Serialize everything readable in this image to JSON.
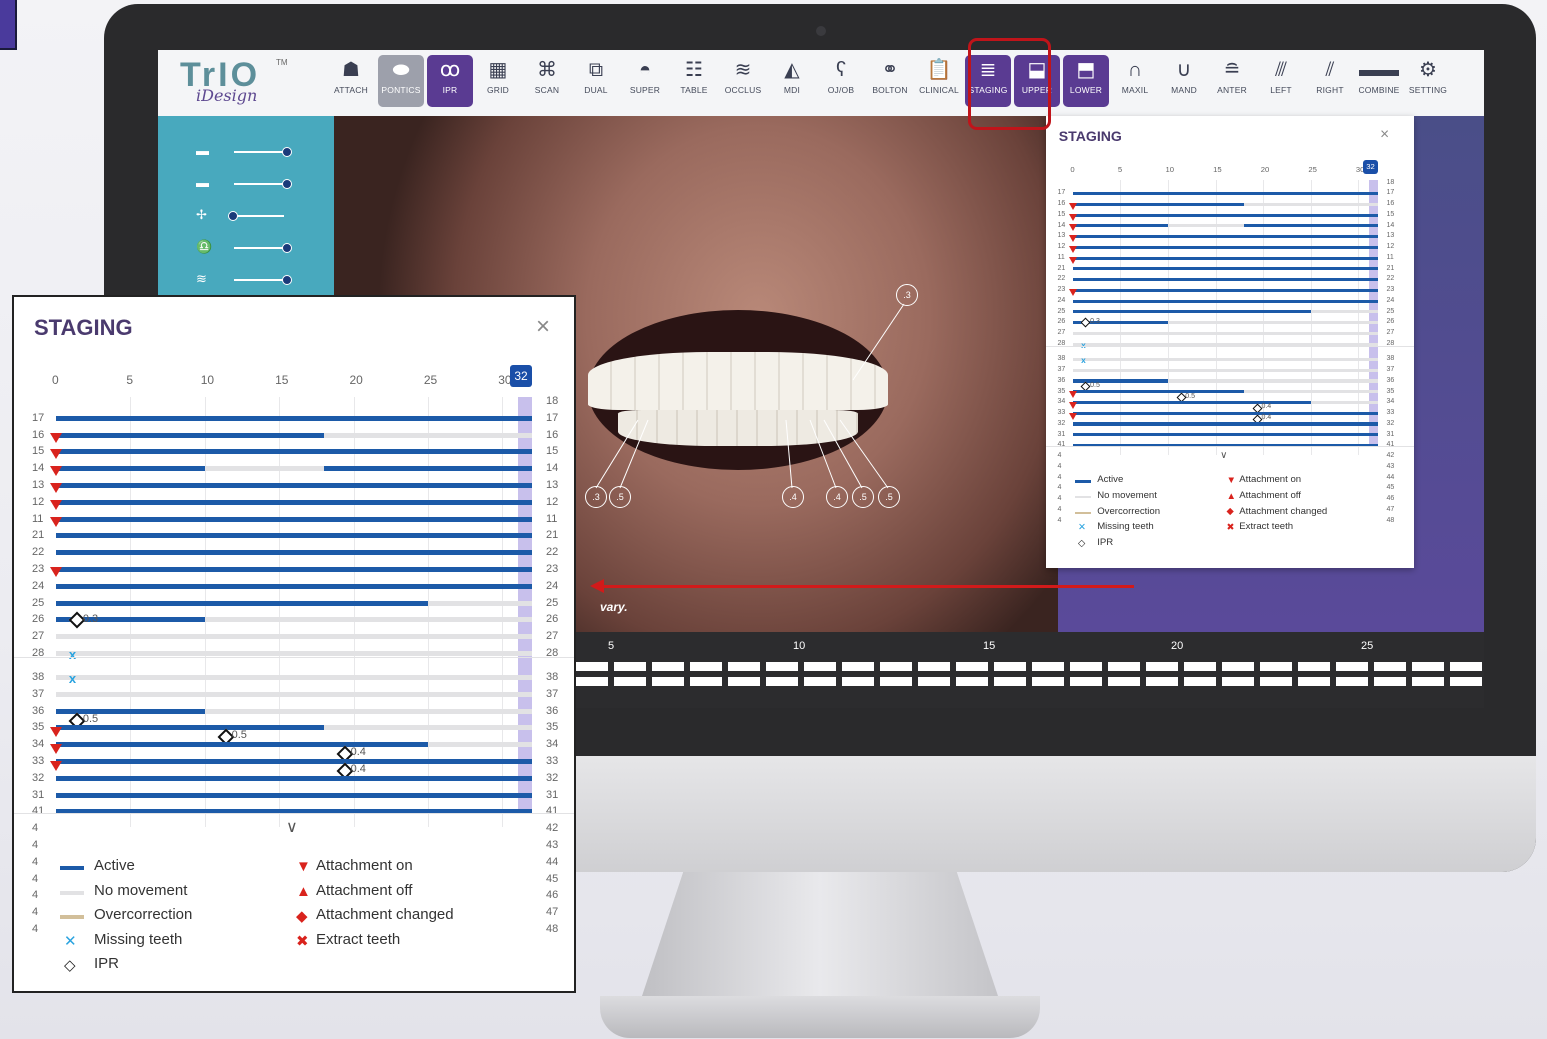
{
  "toolbar": {
    "logo_main": "TrIO",
    "logo_tm": "TM",
    "logo_sub": "iDesign",
    "buttons": [
      {
        "label": "ATTACH",
        "icon": "tooth-attach-icon",
        "glyph": "☗"
      },
      {
        "label": "PONTICS",
        "icon": "pontics-icon",
        "glyph": "⬬"
      },
      {
        "label": "IPR",
        "icon": "ipr-icon",
        "glyph": "ꝏ"
      },
      {
        "label": "GRID",
        "icon": "grid-icon",
        "glyph": "▦"
      },
      {
        "label": "SCAN",
        "icon": "scan-icon",
        "glyph": "⌘"
      },
      {
        "label": "DUAL",
        "icon": "dual-icon",
        "glyph": "⧉"
      },
      {
        "label": "SUPER",
        "icon": "super-icon",
        "glyph": "◓"
      },
      {
        "label": "TABLE",
        "icon": "table-icon",
        "glyph": "☷"
      },
      {
        "label": "OCCLUS",
        "icon": "occlusion-icon",
        "glyph": "≋"
      },
      {
        "label": "MDI",
        "icon": "mdi-icon",
        "glyph": "◭"
      },
      {
        "label": "OJ/OB",
        "icon": "ojob-icon",
        "glyph": "ʕ"
      },
      {
        "label": "BOLTON",
        "icon": "bolton-icon",
        "glyph": "⚭"
      },
      {
        "label": "CLINICAL",
        "icon": "clinical-icon",
        "glyph": "📋"
      },
      {
        "label": "STAGING",
        "icon": "staging-icon",
        "glyph": "≣"
      },
      {
        "label": "UPPER",
        "icon": "upper-jaw-icon",
        "glyph": "⬓"
      },
      {
        "label": "LOWER",
        "icon": "lower-jaw-icon",
        "glyph": "⬒"
      },
      {
        "label": "MAXIL",
        "icon": "maxilla-icon",
        "glyph": "∩"
      },
      {
        "label": "MAND",
        "icon": "mandible-icon",
        "glyph": "∪"
      },
      {
        "label": "ANTER",
        "icon": "anterior-icon",
        "glyph": "≘"
      },
      {
        "label": "LEFT",
        "icon": "left-view-icon",
        "glyph": "⫻"
      },
      {
        "label": "RIGHT",
        "icon": "right-view-icon",
        "glyph": "⫽"
      },
      {
        "label": "COMBINE",
        "icon": "combine-icon",
        "glyph": "▬▬"
      },
      {
        "label": "SETTING",
        "icon": "settings-gear-icon",
        "glyph": "⚙"
      }
    ]
  },
  "viewer": {
    "ipr_markers": [
      ".3",
      ".3",
      ".5",
      ".4",
      ".4",
      ".5",
      ".5"
    ],
    "hint_text": "vary."
  },
  "timeline": {
    "ticks": [
      "5",
      "10",
      "15",
      "20",
      "25"
    ]
  },
  "staging": {
    "title": "STAGING",
    "close": "×",
    "axis": [
      "0",
      "5",
      "10",
      "15",
      "20",
      "25",
      "30"
    ],
    "current_stage": "32",
    "upper_left": [
      "17",
      "16",
      "15",
      "14",
      "13",
      "12",
      "11",
      "21",
      "22",
      "23",
      "24",
      "25",
      "26",
      "27",
      "28"
    ],
    "upper_right": [
      "18",
      "17",
      "16",
      "15",
      "14",
      "13",
      "12",
      "11",
      "21",
      "22",
      "23",
      "24",
      "25",
      "26",
      "27",
      "28"
    ],
    "lower_left": [
      "38",
      "37",
      "36",
      "35",
      "34",
      "33",
      "32",
      "31",
      "41",
      "4",
      "4",
      "4",
      "4",
      "4",
      "4",
      "4"
    ],
    "lower_right": [
      "38",
      "37",
      "36",
      "35",
      "34",
      "33",
      "32",
      "31",
      "41",
      "42",
      "43",
      "44",
      "45",
      "46",
      "47",
      "48"
    ],
    "ipr_values": {
      "u26": "0.3",
      "l36": "0.5",
      "l35": "0.5",
      "l34": "0.4",
      "l33": "0.4"
    },
    "missing_mark": "x",
    "expand": "∨",
    "legend": {
      "active": "Active",
      "no_movement": "No movement",
      "overcorrection": "Overcorrection",
      "missing": "Missing teeth",
      "ipr": "IPR",
      "att_on": "Attachment on",
      "att_off": "Attachment off",
      "att_changed": "Attachment changed",
      "extract": "Extract teeth"
    }
  },
  "colors": {
    "active": "#1c5aa8",
    "no_movement": "#e2e2e4",
    "overcorrection": "#d2bf9a",
    "attachment": "#d9231d",
    "missing": "#2aa3df",
    "accent": "#5a3b92",
    "highlight": "#c0141a"
  }
}
